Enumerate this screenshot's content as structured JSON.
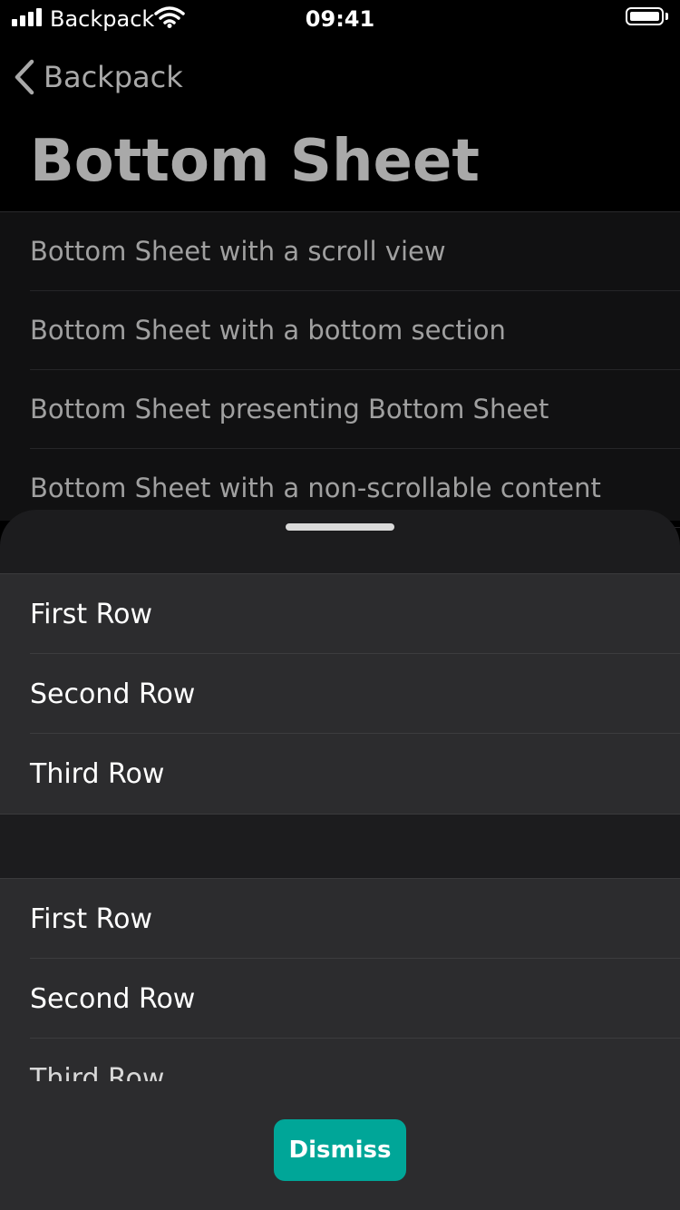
{
  "status_bar": {
    "carrier": "Backpack",
    "time": "09:41"
  },
  "nav": {
    "back_label": "Backpack",
    "title": "Bottom Sheet"
  },
  "list": {
    "items": [
      "Bottom Sheet with a scroll view",
      "Bottom Sheet with a bottom section",
      "Bottom Sheet presenting Bottom Sheet",
      "Bottom Sheet with a non-scrollable content"
    ]
  },
  "sheet": {
    "groups": [
      {
        "rows": [
          "First Row",
          "Second Row",
          "Third Row"
        ]
      },
      {
        "rows": [
          "First Row",
          "Second Row",
          "Third Row"
        ]
      }
    ],
    "dismiss_label": "Dismiss"
  },
  "colors": {
    "accent": "#00a698",
    "sheet_background": "#1c1c1e",
    "row_background": "#2c2c2e"
  },
  "icons": [
    "signal-icon",
    "wifi-icon",
    "battery-icon",
    "chevron-left-icon"
  ]
}
